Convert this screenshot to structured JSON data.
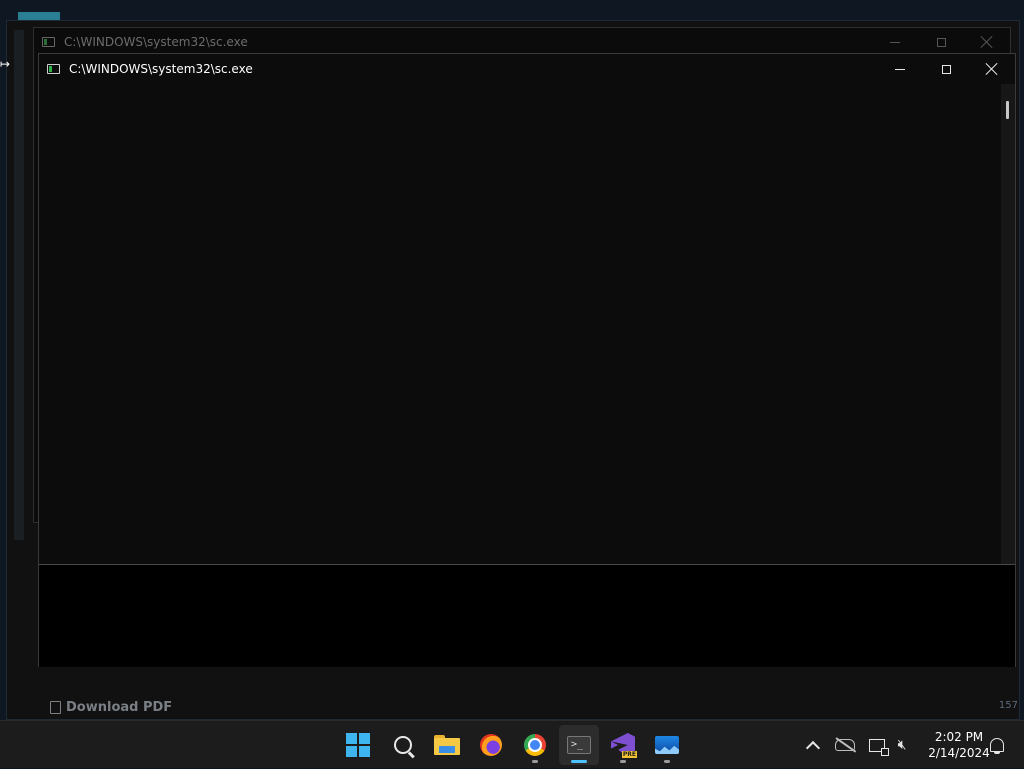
{
  "desktop": {
    "bg_download_label": "Download PDF",
    "bg_page_number": "157"
  },
  "back_window": {
    "title": "C:\\WINDOWS\\system32\\sc.exe"
  },
  "front_window": {
    "title": "C:\\WINDOWS\\system32\\sc.exe",
    "console_text": ""
  },
  "taskbar": {
    "items": [
      {
        "name": "Start",
        "icon": "windows-start-icon"
      },
      {
        "name": "Search",
        "icon": "search-icon"
      },
      {
        "name": "File Explorer",
        "icon": "folder-icon"
      },
      {
        "name": "Firefox",
        "icon": "firefox-icon"
      },
      {
        "name": "Google Chrome",
        "icon": "chrome-icon"
      },
      {
        "name": "Terminal",
        "icon": "terminal-icon",
        "active": true
      },
      {
        "name": "Visual Studio Preview",
        "icon": "visual-studio-icon",
        "badge": "PRE"
      },
      {
        "name": "Monitor",
        "icon": "monitor-icon"
      }
    ],
    "tray": {
      "clock_time": "2:02 PM",
      "clock_date": "2/14/2024"
    }
  },
  "colors": {
    "console_bg": "#0c0c0c",
    "taskbar_bg": "#1c1c1c",
    "accent": "#4cc2ff"
  }
}
